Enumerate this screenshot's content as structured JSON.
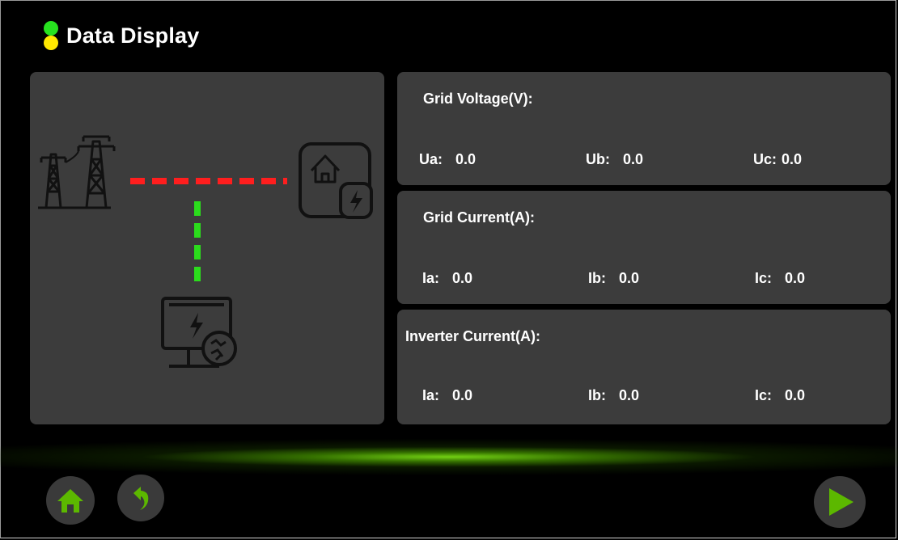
{
  "header": {
    "title": "Data Display"
  },
  "colors": {
    "status_green": "#27e21f",
    "status_yellow": "#ffe800",
    "grid_line": "#ff1e1e",
    "load_line": "#2bdc1c",
    "accent_green": "#5cb800",
    "panel_bg": "#3c3c3c"
  },
  "diagram": {
    "grid_icon": "power-tower-icon",
    "home_icon": "home-power-icon",
    "inverter_icon": "inverter-monitor-icon"
  },
  "grid_voltage": {
    "title": "Grid Voltage(V):",
    "a_label": "Ua:",
    "a_value": "0.0",
    "b_label": "Ub:",
    "b_value": "0.0",
    "c_label": "Uc:",
    "c_value": "0.0"
  },
  "grid_current": {
    "title": "Grid Current(A):",
    "a_label": "Ia:",
    "a_value": "0.0",
    "b_label": "Ib:",
    "b_value": "0.0",
    "c_label": "Ic:",
    "c_value": "0.0"
  },
  "inverter_current": {
    "title": "Inverter Current(A):",
    "a_label": "Ia:",
    "a_value": "0.0",
    "b_label": "Ib:",
    "b_value": "0.0",
    "c_label": "Ic:",
    "c_value": "0.0"
  },
  "nav": {
    "home_icon": "home-icon",
    "back_icon": "back-arrow-icon",
    "next_icon": "play-arrow-icon"
  }
}
